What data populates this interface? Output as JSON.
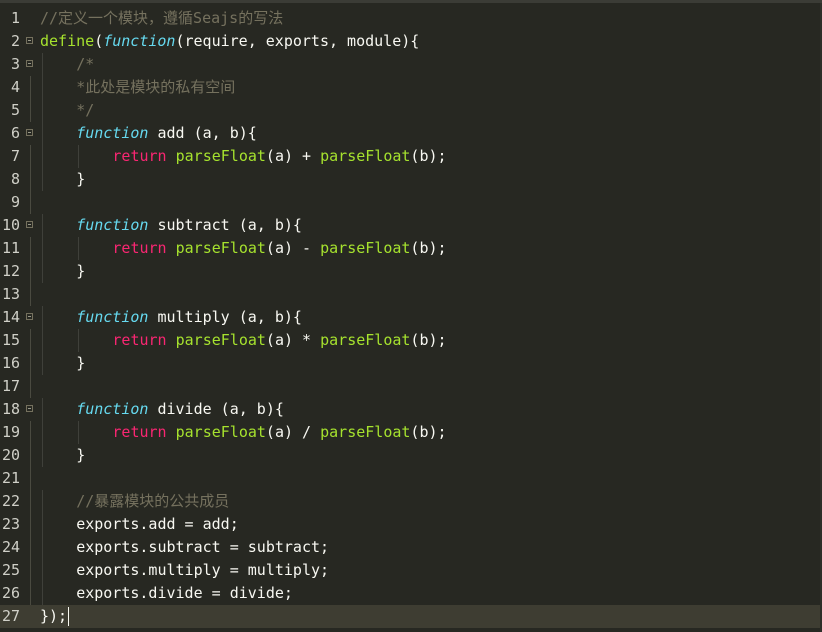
{
  "editor": {
    "colors": {
      "background": "#272822",
      "comment": "#75715e",
      "keyword": "#f92672",
      "storage": "#66d9ef",
      "function": "#a6e22e",
      "text": "#f8f8f2"
    },
    "current_line": 27,
    "lines": [
      {
        "n": "1",
        "fold": false,
        "indent": 0,
        "tokens": [
          {
            "t": "comment",
            "v": "//定义一个模块，遵循Seajs的写法"
          }
        ]
      },
      {
        "n": "2",
        "fold": true,
        "indent": 0,
        "tokens": [
          {
            "t": "func",
            "v": "define"
          },
          {
            "t": "plain",
            "v": "("
          },
          {
            "t": "storage",
            "v": "function"
          },
          {
            "t": "plain",
            "v": "(require, exports, module){"
          }
        ]
      },
      {
        "n": "3",
        "fold": true,
        "indent": 1,
        "tokens": [
          {
            "t": "comment",
            "v": "/*"
          }
        ]
      },
      {
        "n": "4",
        "fold": false,
        "indent": 1,
        "tokens": [
          {
            "t": "comment",
            "v": "*此处是模块的私有空间"
          }
        ]
      },
      {
        "n": "5",
        "fold": false,
        "indent": 1,
        "tokens": [
          {
            "t": "comment",
            "v": "*/"
          }
        ]
      },
      {
        "n": "6",
        "fold": true,
        "indent": 1,
        "tokens": [
          {
            "t": "storage",
            "v": "function"
          },
          {
            "t": "plain",
            "v": " add (a, b){"
          }
        ]
      },
      {
        "n": "7",
        "fold": false,
        "indent": 2,
        "tokens": [
          {
            "t": "keyword",
            "v": "return"
          },
          {
            "t": "plain",
            "v": " "
          },
          {
            "t": "func",
            "v": "parseFloat"
          },
          {
            "t": "plain",
            "v": "(a) + "
          },
          {
            "t": "func",
            "v": "parseFloat"
          },
          {
            "t": "plain",
            "v": "(b);"
          }
        ]
      },
      {
        "n": "8",
        "fold": false,
        "indent": 1,
        "tokens": [
          {
            "t": "plain",
            "v": "}"
          }
        ]
      },
      {
        "n": "9",
        "fold": false,
        "indent": 0,
        "tokens": []
      },
      {
        "n": "10",
        "fold": true,
        "indent": 1,
        "tokens": [
          {
            "t": "storage",
            "v": "function"
          },
          {
            "t": "plain",
            "v": " subtract (a, b){"
          }
        ]
      },
      {
        "n": "11",
        "fold": false,
        "indent": 2,
        "tokens": [
          {
            "t": "keyword",
            "v": "return"
          },
          {
            "t": "plain",
            "v": " "
          },
          {
            "t": "func",
            "v": "parseFloat"
          },
          {
            "t": "plain",
            "v": "(a) - "
          },
          {
            "t": "func",
            "v": "parseFloat"
          },
          {
            "t": "plain",
            "v": "(b);"
          }
        ]
      },
      {
        "n": "12",
        "fold": false,
        "indent": 1,
        "tokens": [
          {
            "t": "plain",
            "v": "}"
          }
        ]
      },
      {
        "n": "13",
        "fold": false,
        "indent": 0,
        "tokens": []
      },
      {
        "n": "14",
        "fold": true,
        "indent": 1,
        "tokens": [
          {
            "t": "storage",
            "v": "function"
          },
          {
            "t": "plain",
            "v": " multiply (a, b){"
          }
        ]
      },
      {
        "n": "15",
        "fold": false,
        "indent": 2,
        "tokens": [
          {
            "t": "keyword",
            "v": "return"
          },
          {
            "t": "plain",
            "v": " "
          },
          {
            "t": "func",
            "v": "parseFloat"
          },
          {
            "t": "plain",
            "v": "(a) * "
          },
          {
            "t": "func",
            "v": "parseFloat"
          },
          {
            "t": "plain",
            "v": "(b);"
          }
        ]
      },
      {
        "n": "16",
        "fold": false,
        "indent": 1,
        "tokens": [
          {
            "t": "plain",
            "v": "}"
          }
        ]
      },
      {
        "n": "17",
        "fold": false,
        "indent": 0,
        "tokens": []
      },
      {
        "n": "18",
        "fold": true,
        "indent": 1,
        "tokens": [
          {
            "t": "storage",
            "v": "function"
          },
          {
            "t": "plain",
            "v": " divide (a, b){"
          }
        ]
      },
      {
        "n": "19",
        "fold": false,
        "indent": 2,
        "tokens": [
          {
            "t": "keyword",
            "v": "return"
          },
          {
            "t": "plain",
            "v": " "
          },
          {
            "t": "func",
            "v": "parseFloat"
          },
          {
            "t": "plain",
            "v": "(a) / "
          },
          {
            "t": "func",
            "v": "parseFloat"
          },
          {
            "t": "plain",
            "v": "(b);"
          }
        ]
      },
      {
        "n": "20",
        "fold": false,
        "indent": 1,
        "tokens": [
          {
            "t": "plain",
            "v": "}"
          }
        ]
      },
      {
        "n": "21",
        "fold": false,
        "indent": 0,
        "tokens": []
      },
      {
        "n": "22",
        "fold": false,
        "indent": 1,
        "tokens": [
          {
            "t": "comment",
            "v": "//暴露模块的公共成员"
          }
        ]
      },
      {
        "n": "23",
        "fold": false,
        "indent": 1,
        "tokens": [
          {
            "t": "plain",
            "v": "exports.add = add;"
          }
        ]
      },
      {
        "n": "24",
        "fold": false,
        "indent": 1,
        "tokens": [
          {
            "t": "plain",
            "v": "exports.subtract = subtract;"
          }
        ]
      },
      {
        "n": "25",
        "fold": false,
        "indent": 1,
        "tokens": [
          {
            "t": "plain",
            "v": "exports.multiply = multiply;"
          }
        ]
      },
      {
        "n": "26",
        "fold": false,
        "indent": 1,
        "tokens": [
          {
            "t": "plain",
            "v": "exports.divide = divide;"
          }
        ]
      },
      {
        "n": "27",
        "fold": false,
        "indent": 0,
        "tokens": [
          {
            "t": "plain",
            "v": "});"
          }
        ]
      }
    ]
  }
}
